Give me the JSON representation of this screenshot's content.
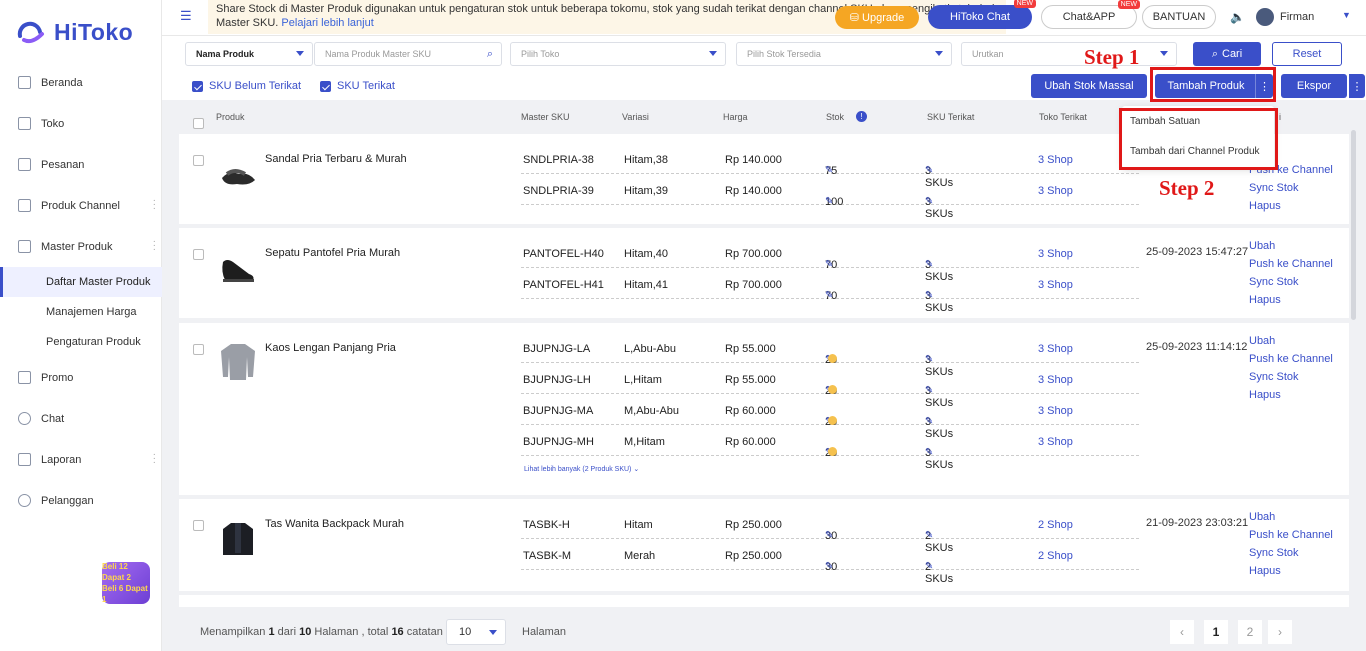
{
  "app": {
    "logo": "HiToko"
  },
  "sidebar": {
    "items": [
      {
        "label": "Beranda",
        "icon": "monitor-icon"
      },
      {
        "label": "Toko",
        "icon": "store-icon"
      },
      {
        "label": "Pesanan",
        "icon": "list-icon"
      },
      {
        "label": "Produk Channel",
        "icon": "grid-icon"
      },
      {
        "label": "Master Produk",
        "icon": "box-icon"
      }
    ],
    "sub_items": [
      "Daftar Master Produk",
      "Manajemen Harga",
      "Pengaturan Produk"
    ],
    "items_after": [
      {
        "label": "Promo",
        "icon": "promo-icon"
      },
      {
        "label": "Chat",
        "icon": "chat-icon"
      },
      {
        "label": "Laporan",
        "icon": "report-icon"
      },
      {
        "label": "Pelanggan",
        "icon": "users-icon"
      }
    ],
    "promo_line1": "Beli 12 Dapat 2",
    "promo_line2": "Beli 6 Dapat 1"
  },
  "topbar": {
    "notice": "Share Stock di Master Produk digunakan untuk pengaturan stok untuk beberapa tokomu, stok yang sudah terikat dengan channel SKU akan mengikuti stok dari Master SKU.",
    "notice_link": "Pelajari lebih lanjut",
    "upgrade": "Upgrade",
    "hitoko_chat": "HiToko Chat",
    "chat_app": "Chat&APP",
    "bantuan": "BANTUAN",
    "new_badge": "NEW",
    "username": "Firman"
  },
  "filters": {
    "field_select": "Nama Produk",
    "search_placeholder": "Nama Produk Master SKU",
    "toko_placeholder": "Pilih Toko",
    "stok_placeholder": "Pilih Stok Tersedia",
    "urutkan_placeholder": "Urutkan",
    "cari": "Cari",
    "reset": "Reset",
    "sku_belum": "SKU Belum Terikat",
    "sku_terikat": "SKU Terikat",
    "ubah_stok": "Ubah Stok Massal",
    "tambah_produk": "Tambah Produk",
    "ekspor": "Ekspor"
  },
  "table": {
    "headers": [
      "Produk",
      "Master SKU",
      "Variasi",
      "Harga",
      "Stok",
      "SKU Terikat",
      "Toko Terikat",
      "i"
    ],
    "products": [
      {
        "name": "Sandal Pria Terbaru & Murah",
        "date": "",
        "rows": [
          {
            "sku": "SNDLPRIA-38",
            "var": "Hitam,38",
            "price": "Rp 140.000",
            "stock": "75",
            "skus": "3 SKUs",
            "shop": "3 Shop"
          },
          {
            "sku": "SNDLPRIA-39",
            "var": "Hitam,39",
            "price": "Rp 140.000",
            "stock": "100",
            "skus": "3 SKUs",
            "shop": "3 Shop"
          }
        ]
      },
      {
        "name": "Sepatu Pantofel Pria Murah",
        "date": "25-09-2023 15:47:27",
        "rows": [
          {
            "sku": "PANTOFEL-H40",
            "var": "Hitam,40",
            "price": "Rp 700.000",
            "stock": "70",
            "skus": "3 SKUs",
            "shop": "3 Shop"
          },
          {
            "sku": "PANTOFEL-H41",
            "var": "Hitam,41",
            "price": "Rp 700.000",
            "stock": "70",
            "skus": "3 SKUs",
            "shop": "3 Shop"
          }
        ]
      },
      {
        "name": "Kaos Lengan Panjang Pria",
        "date": "25-09-2023 11:14:12",
        "rows": [
          {
            "sku": "BJUPNJG-LA",
            "var": "L,Abu-Abu",
            "price": "Rp 55.000",
            "stock": "20",
            "skus": "3 SKUs",
            "shop": "3 Shop"
          },
          {
            "sku": "BJUPNJG-LH",
            "var": "L,Hitam",
            "price": "Rp 55.000",
            "stock": "20",
            "skus": "3 SKUs",
            "shop": "3 Shop"
          },
          {
            "sku": "BJUPNJG-MA",
            "var": "M,Abu-Abu",
            "price": "Rp 60.000",
            "stock": "20",
            "skus": "3 SKUs",
            "shop": "3 Shop"
          },
          {
            "sku": "BJUPNJG-MH",
            "var": "M,Hitam",
            "price": "Rp 60.000",
            "stock": "20",
            "skus": "3 SKUs",
            "shop": "3 Shop"
          }
        ],
        "more": "Lihat lebih banyak (2 Produk SKU)"
      },
      {
        "name": "Tas Wanita Backpack Murah",
        "date": "21-09-2023 23:03:21",
        "rows": [
          {
            "sku": "TASBK-H",
            "var": "Hitam",
            "price": "Rp 250.000",
            "stock": "30",
            "skus": "2 SKUs",
            "shop": "2 Shop"
          },
          {
            "sku": "TASBK-M",
            "var": "Merah",
            "price": "Rp 250.000",
            "stock": "30",
            "skus": "2 SKUs",
            "shop": "2 Shop"
          }
        ]
      }
    ],
    "actions": [
      "Ubah",
      "Push ke Channel",
      "Sync Stok",
      "Hapus"
    ]
  },
  "dropdown": {
    "items": [
      "Tambah Satuan",
      "Tambah dari Channel Produk"
    ]
  },
  "annotations": {
    "step1": "Step 1",
    "step2": "Step 2"
  },
  "footer": {
    "prefix": "Menampilkan",
    "page": "1",
    "mid": "dari",
    "total_pages": "10",
    "mid2": "Halaman , total",
    "total": "16",
    "suffix": "catatan",
    "page_size": "10",
    "halaman": "Halaman",
    "pages": [
      "1",
      "2"
    ]
  },
  "colors": {
    "primary": "#3a4fc9",
    "annotation": "#e01818",
    "warning": "#f5a623"
  }
}
